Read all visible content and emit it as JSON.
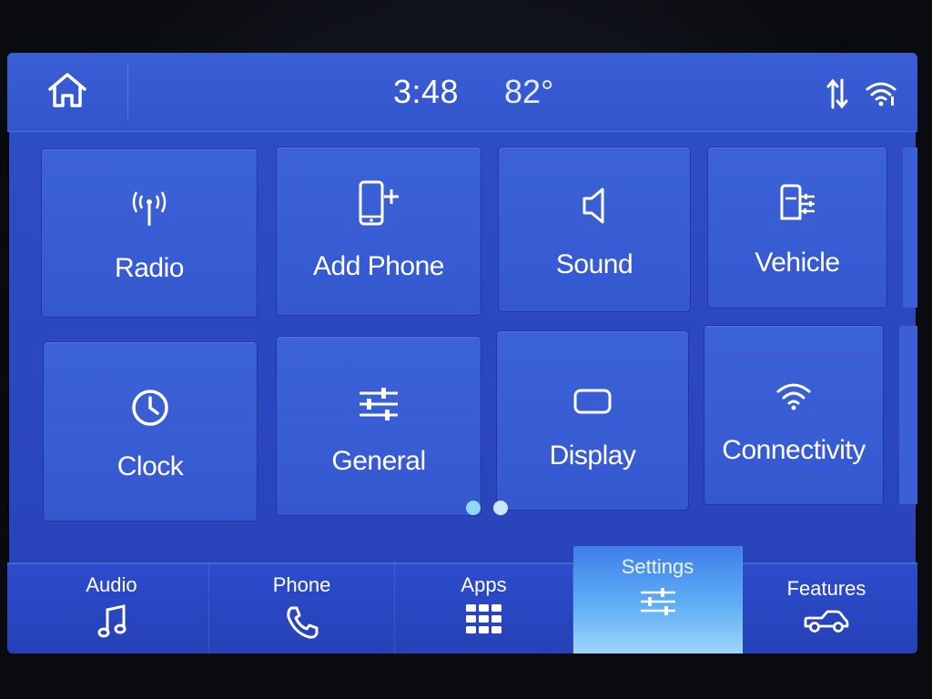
{
  "status_bar": {
    "time": "3:48",
    "temperature": "82°",
    "icons": [
      "home-icon",
      "data-transfer-icon",
      "wifi-icon"
    ]
  },
  "tiles": [
    {
      "label": "Radio",
      "icon": "radio-antenna-icon"
    },
    {
      "label": "Add Phone",
      "icon": "add-phone-icon"
    },
    {
      "label": "Sound",
      "icon": "speaker-icon"
    },
    {
      "label": "Vehicle",
      "icon": "vehicle-settings-icon"
    },
    {
      "label": "Clock",
      "icon": "clock-icon"
    },
    {
      "label": "General",
      "icon": "sliders-icon"
    },
    {
      "label": "Display",
      "icon": "display-icon"
    },
    {
      "label": "Connectivity",
      "icon": "wifi-icon"
    }
  ],
  "pager": {
    "page": 1,
    "total": 2
  },
  "nav": {
    "audio": "Audio",
    "phone": "Phone",
    "apps": "Apps",
    "settings": "Settings",
    "features": "Features",
    "active": "settings"
  },
  "colors": {
    "screen_bg": "#2f50c6",
    "tile_bg": "#3c62d8",
    "active_tab": "#5fb0f5",
    "pager_dot": "#8fd8ff"
  }
}
